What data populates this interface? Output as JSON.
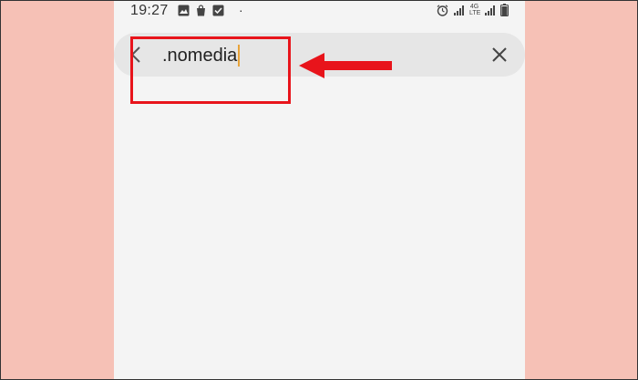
{
  "status_bar": {
    "time": "19:27",
    "left_icons": [
      "image-icon",
      "bag-icon",
      "checkbox-icon"
    ],
    "dot": "·",
    "network_label_top": "4G",
    "network_label_bottom": "LTE"
  },
  "search": {
    "value": ".nomedia"
  },
  "colors": {
    "page_background": "#f6c1b6",
    "screen_background": "#f4f4f4",
    "search_bar": "#e6e6e6",
    "annotation_red": "#e8141b",
    "caret": "#e8a33a"
  }
}
